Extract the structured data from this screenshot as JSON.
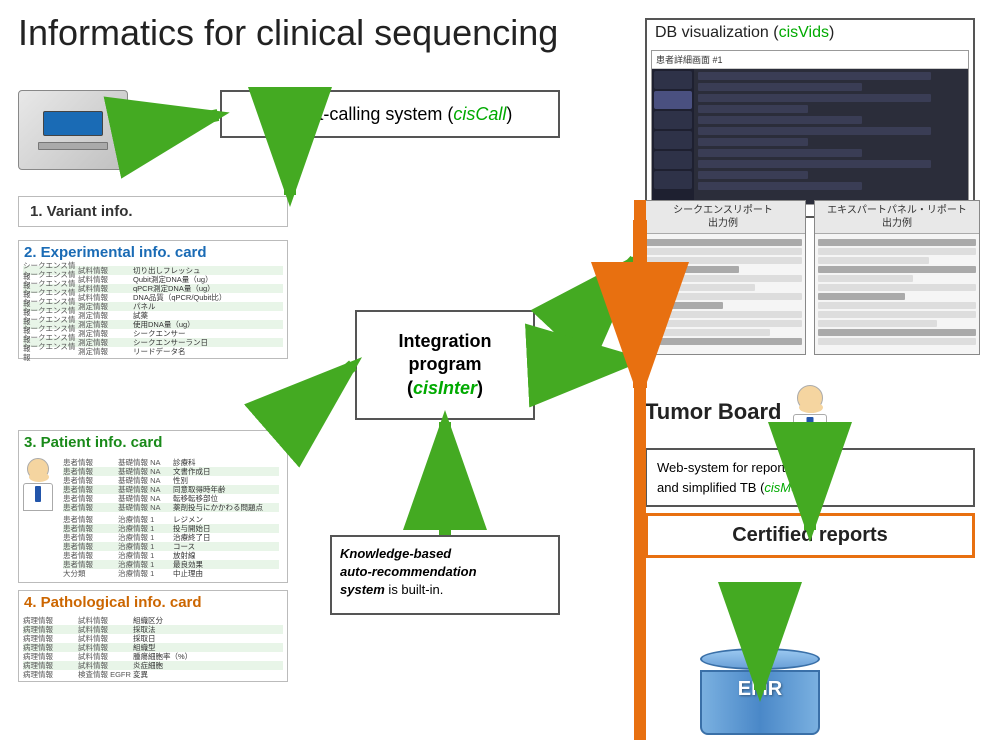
{
  "title": "Informatics for clinical sequencing",
  "variant_calling": {
    "label": "Variant-calling system (",
    "system_name": "cisCall",
    "closing": ")"
  },
  "db_viz": {
    "title": "DB visualization (",
    "system_name": "cisVids",
    "closing": ")",
    "inner_title": "患者詳細画面 #1"
  },
  "sections": {
    "variant": {
      "title": "1. Variant info."
    },
    "experimental": {
      "title": "2. Experimental info. card",
      "rows": [
        [
          "シークエンス情報",
          "試料情報",
          "切り出しフレッシュ"
        ],
        [
          "シークエンス情報",
          "試料情報",
          "Qubit測定DNA量（ug）"
        ],
        [
          "シークエンス情報",
          "試料情報",
          "qPCR測定DNA量（ug）"
        ],
        [
          "シークエンス情報",
          "試料情報",
          "DNA品質（qPCR/Qubit比）"
        ],
        [
          "シークエンス情報",
          "測定情報",
          "パネル"
        ],
        [
          "シークエンス情報",
          "測定情報",
          "試薬"
        ],
        [
          "シークエンス情報",
          "測定情報",
          "使用DNA量（ug）"
        ],
        [
          "シークエンス情報",
          "測定情報",
          "シークエンサー"
        ],
        [
          "シークエンス情報",
          "測定情報",
          "シークエンサーラン日"
        ],
        [
          "シークエンス情報",
          "測定情報",
          "リードデータ名"
        ]
      ]
    },
    "patient": {
      "title": "3. Patient info. card",
      "rows": [
        [
          "患者情報",
          "基礎情報 NA",
          "診療科"
        ],
        [
          "患者情報",
          "基礎情報 NA",
          "文書作成日"
        ],
        [
          "患者情報",
          "基礎情報 NA",
          "性別"
        ],
        [
          "患者情報",
          "基礎情報 NA",
          "同意取得時年齢"
        ],
        [
          "患者情報",
          "基礎情報 NA",
          "転移転移部位"
        ],
        [
          "患者情報",
          "基礎情報 NA",
          "薬剤投与にかかわる問題点"
        ],
        [
          "患者情報",
          "治療情報 1",
          "レジメン"
        ],
        [
          "患者情報",
          "治療情報 1",
          "投与開始日"
        ],
        [
          "患者情報",
          "治療情報 1",
          "治療終了日"
        ],
        [
          "患者情報",
          "治療情報 1",
          "コース"
        ],
        [
          "患者情報",
          "治療情報 1",
          "放射線"
        ],
        [
          "患者情報",
          "治療情報 1",
          "最良効果"
        ],
        [
          "大分類",
          "治療情報 1",
          "中止理由"
        ]
      ]
    },
    "pathological": {
      "title": "4. Pathological info. card",
      "rows": [
        [
          "病理情報",
          "試料情報",
          "組織区分"
        ],
        [
          "病理情報",
          "試料情報",
          "採取法"
        ],
        [
          "病理情報",
          "試料情報",
          "採取日"
        ],
        [
          "病理情報",
          "試料情報",
          "組織型"
        ],
        [
          "病理情報",
          "試料情報",
          "腫瘍細胞率（%）"
        ],
        [
          "病理情報",
          "試料情報",
          "炎症細胞"
        ],
        [
          "病理情報",
          "検査情報 EGFR",
          "変異"
        ]
      ]
    }
  },
  "integration": {
    "line1": "Integration",
    "line2": "program",
    "line3": "(",
    "system_name": "cisInter",
    "closing": ")"
  },
  "knowledge": {
    "text1": "Knowledge-based",
    "text2": "auto-recommendation",
    "text3": "system",
    "text4": " is built-in."
  },
  "report_panels": {
    "left": {
      "title": "シークエンスリポート\n出力例"
    },
    "right": {
      "title": "エキスパートパネル・リポート\n出力例"
    }
  },
  "tumor_board": {
    "title": "Tumor Board",
    "web_system_text": "Web-system for report editing\nand simplified TB (",
    "system_name": "cisMedi",
    "closing": ")"
  },
  "certified_reports": {
    "label": "Certified reports"
  },
  "emr": {
    "label": "EMR"
  },
  "colors": {
    "green_accent": "#00aa00",
    "blue_accent": "#1a6bb5",
    "orange_accent": "#e87010",
    "arrow_green": "#44aa22",
    "arrow_orange": "#e87010"
  }
}
